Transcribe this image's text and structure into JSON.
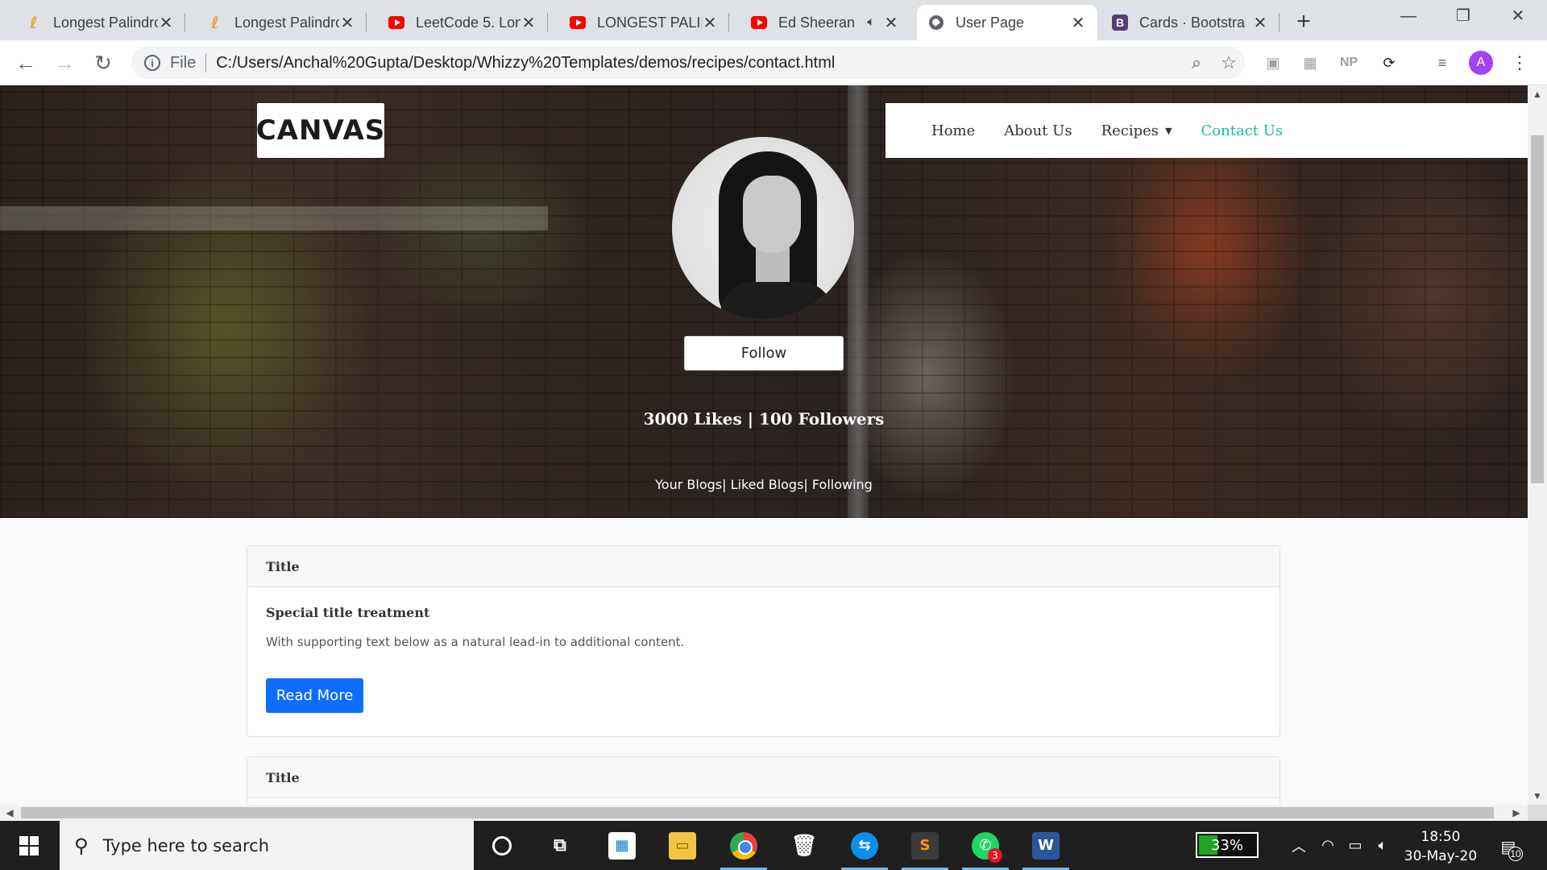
{
  "browser": {
    "tabs": [
      {
        "title": "Longest Palindro",
        "icon": "leetcode-icon",
        "active": false
      },
      {
        "title": "Longest Palindro",
        "icon": "leetcode-icon",
        "active": false
      },
      {
        "title": "LeetCode 5. Lon",
        "icon": "youtube-icon",
        "active": false
      },
      {
        "title": "LONGEST PALIN",
        "icon": "youtube-icon",
        "active": false
      },
      {
        "title": "Ed Sheeran",
        "icon": "youtube-icon",
        "active": false,
        "audio": true
      },
      {
        "title": "User Page",
        "icon": "globe-icon",
        "active": true
      },
      {
        "title": "Cards · Bootstra",
        "icon": "bootstrap-icon",
        "active": false
      }
    ],
    "new_tab": "+",
    "address": {
      "scheme": "File",
      "url": "C:/Users/Anchal%20Gupta/Desktop/Whizzy%20Templates/demos/recipes/contact.html"
    },
    "extension_np": "NP",
    "profile_initial": "A"
  },
  "site": {
    "logo_text": "CANVAS",
    "nav": [
      {
        "label": "Home",
        "active": false
      },
      {
        "label": "About Us",
        "active": false
      },
      {
        "label": "Recipes",
        "active": false,
        "dropdown": true
      },
      {
        "label": "Contact Us",
        "active": true
      }
    ],
    "accent_color": "#1abc9c"
  },
  "profile": {
    "follow_label": "Follow",
    "stats": "3000 Likes | 100 Followers",
    "links": "Your Blogs| Liked Blogs| Following"
  },
  "cards": [
    {
      "header": "Title",
      "title": "Special title treatment",
      "text": "With supporting text below as a natural lead-in to additional content.",
      "button": "Read More"
    },
    {
      "header": "Title"
    }
  ],
  "taskbar": {
    "search_placeholder": "Type here to search",
    "battery": "33%",
    "time": "18:50",
    "date": "30-May-20",
    "whatsapp_badge": "3",
    "notifications": "10",
    "battery_level": 0.33
  }
}
